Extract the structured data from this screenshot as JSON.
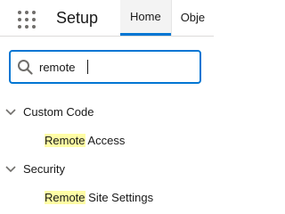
{
  "header": {
    "app_title": "Setup",
    "app_launcher_icon": "waffle-grid-icon",
    "tabs": [
      {
        "label": "Home",
        "active": true
      },
      {
        "label": "Obje"
      }
    ]
  },
  "search": {
    "value": "remote",
    "icon": "search-icon"
  },
  "tree": {
    "groups": [
      {
        "label": "Custom Code",
        "expanded": true,
        "items": [
          {
            "match": "Remote",
            "rest": " Access"
          }
        ]
      },
      {
        "label": "Security",
        "expanded": true,
        "items": [
          {
            "match": "Remote",
            "rest": " Site Settings"
          }
        ]
      }
    ]
  },
  "colors": {
    "accent": "#0176d3",
    "highlight": "#fffda5",
    "icon_gray": "#706e6b"
  }
}
